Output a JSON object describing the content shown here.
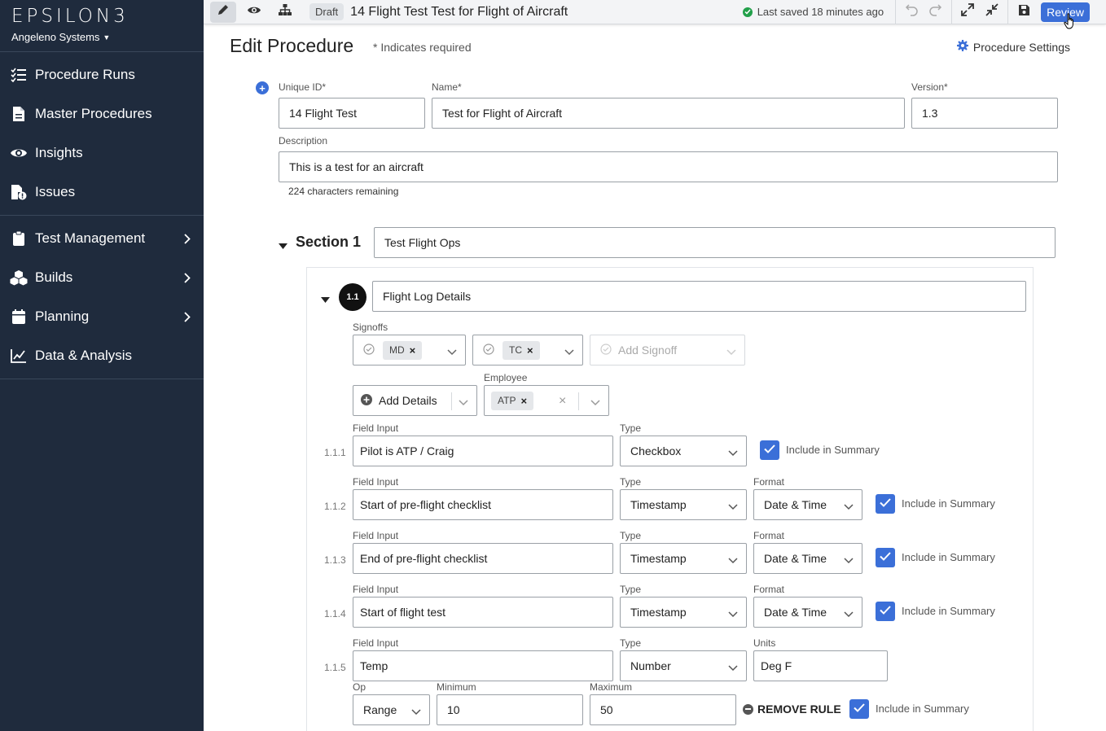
{
  "sidebar": {
    "logo": "EPSILON3",
    "org": "Angeleno Systems",
    "items": [
      {
        "label": "Procedure Runs",
        "icon": "checklist-icon"
      },
      {
        "label": "Master Procedures",
        "icon": "document-icon"
      },
      {
        "label": "Insights",
        "icon": "eye-icon"
      },
      {
        "label": "Issues",
        "icon": "issue-file-icon"
      },
      {
        "label": "Test Management",
        "icon": "clipboard-icon"
      },
      {
        "label": "Builds",
        "icon": "cubes-icon"
      },
      {
        "label": "Planning",
        "icon": "calendar-icon"
      },
      {
        "label": "Data & Analysis",
        "icon": "line-chart-icon"
      }
    ]
  },
  "toolbar": {
    "draft": "Draft",
    "procedure_title": "14 Flight Test Test for Flight of Aircraft",
    "saved_status": "Last saved 18 minutes ago",
    "review_label": "Review"
  },
  "header": {
    "title": "Edit Procedure",
    "required_note": "* Indicates required",
    "settings_label": "Procedure Settings"
  },
  "form": {
    "unique_id_label": "Unique ID*",
    "unique_id": "14 Flight Test",
    "name_label": "Name*",
    "name": "Test for Flight of Aircraft",
    "version_label": "Version*",
    "version": "1.3",
    "description_label": "Description",
    "description": "This is a test for an aircraft",
    "chars_remaining": "224 characters remaining"
  },
  "section": {
    "label": "Section 1",
    "name": "Test Flight Ops",
    "step": {
      "number": "1.1",
      "name": "Flight Log Details",
      "signoffs_label": "Signoffs",
      "signoffs": [
        "MD",
        "TC"
      ],
      "add_signoff": "Add Signoff",
      "add_details": "Add Details",
      "employee_label": "Employee",
      "employee": "ATP",
      "field_input_label": "Field Input",
      "type_label": "Type",
      "format_label": "Format",
      "units_label": "Units",
      "include_label": "Include in Summary",
      "fields": [
        {
          "num": "1.1.1",
          "input": "Pilot is ATP / Craig",
          "type": "Checkbox"
        },
        {
          "num": "1.1.2",
          "input": "Start of pre-flight checklist",
          "type": "Timestamp",
          "format": "Date & Time"
        },
        {
          "num": "1.1.3",
          "input": "End of pre-flight checklist",
          "type": "Timestamp",
          "format": "Date & Time"
        },
        {
          "num": "1.1.4",
          "input": "Start of flight test",
          "type": "Timestamp",
          "format": "Date & Time"
        },
        {
          "num": "1.1.5",
          "input": "Temp",
          "type": "Number",
          "units": "Deg F"
        }
      ],
      "rule": {
        "op_label": "Op",
        "op": "Range",
        "min_label": "Minimum",
        "min": "10",
        "max_label": "Maximum",
        "max": "50",
        "remove_label": "REMOVE RULE"
      }
    }
  }
}
